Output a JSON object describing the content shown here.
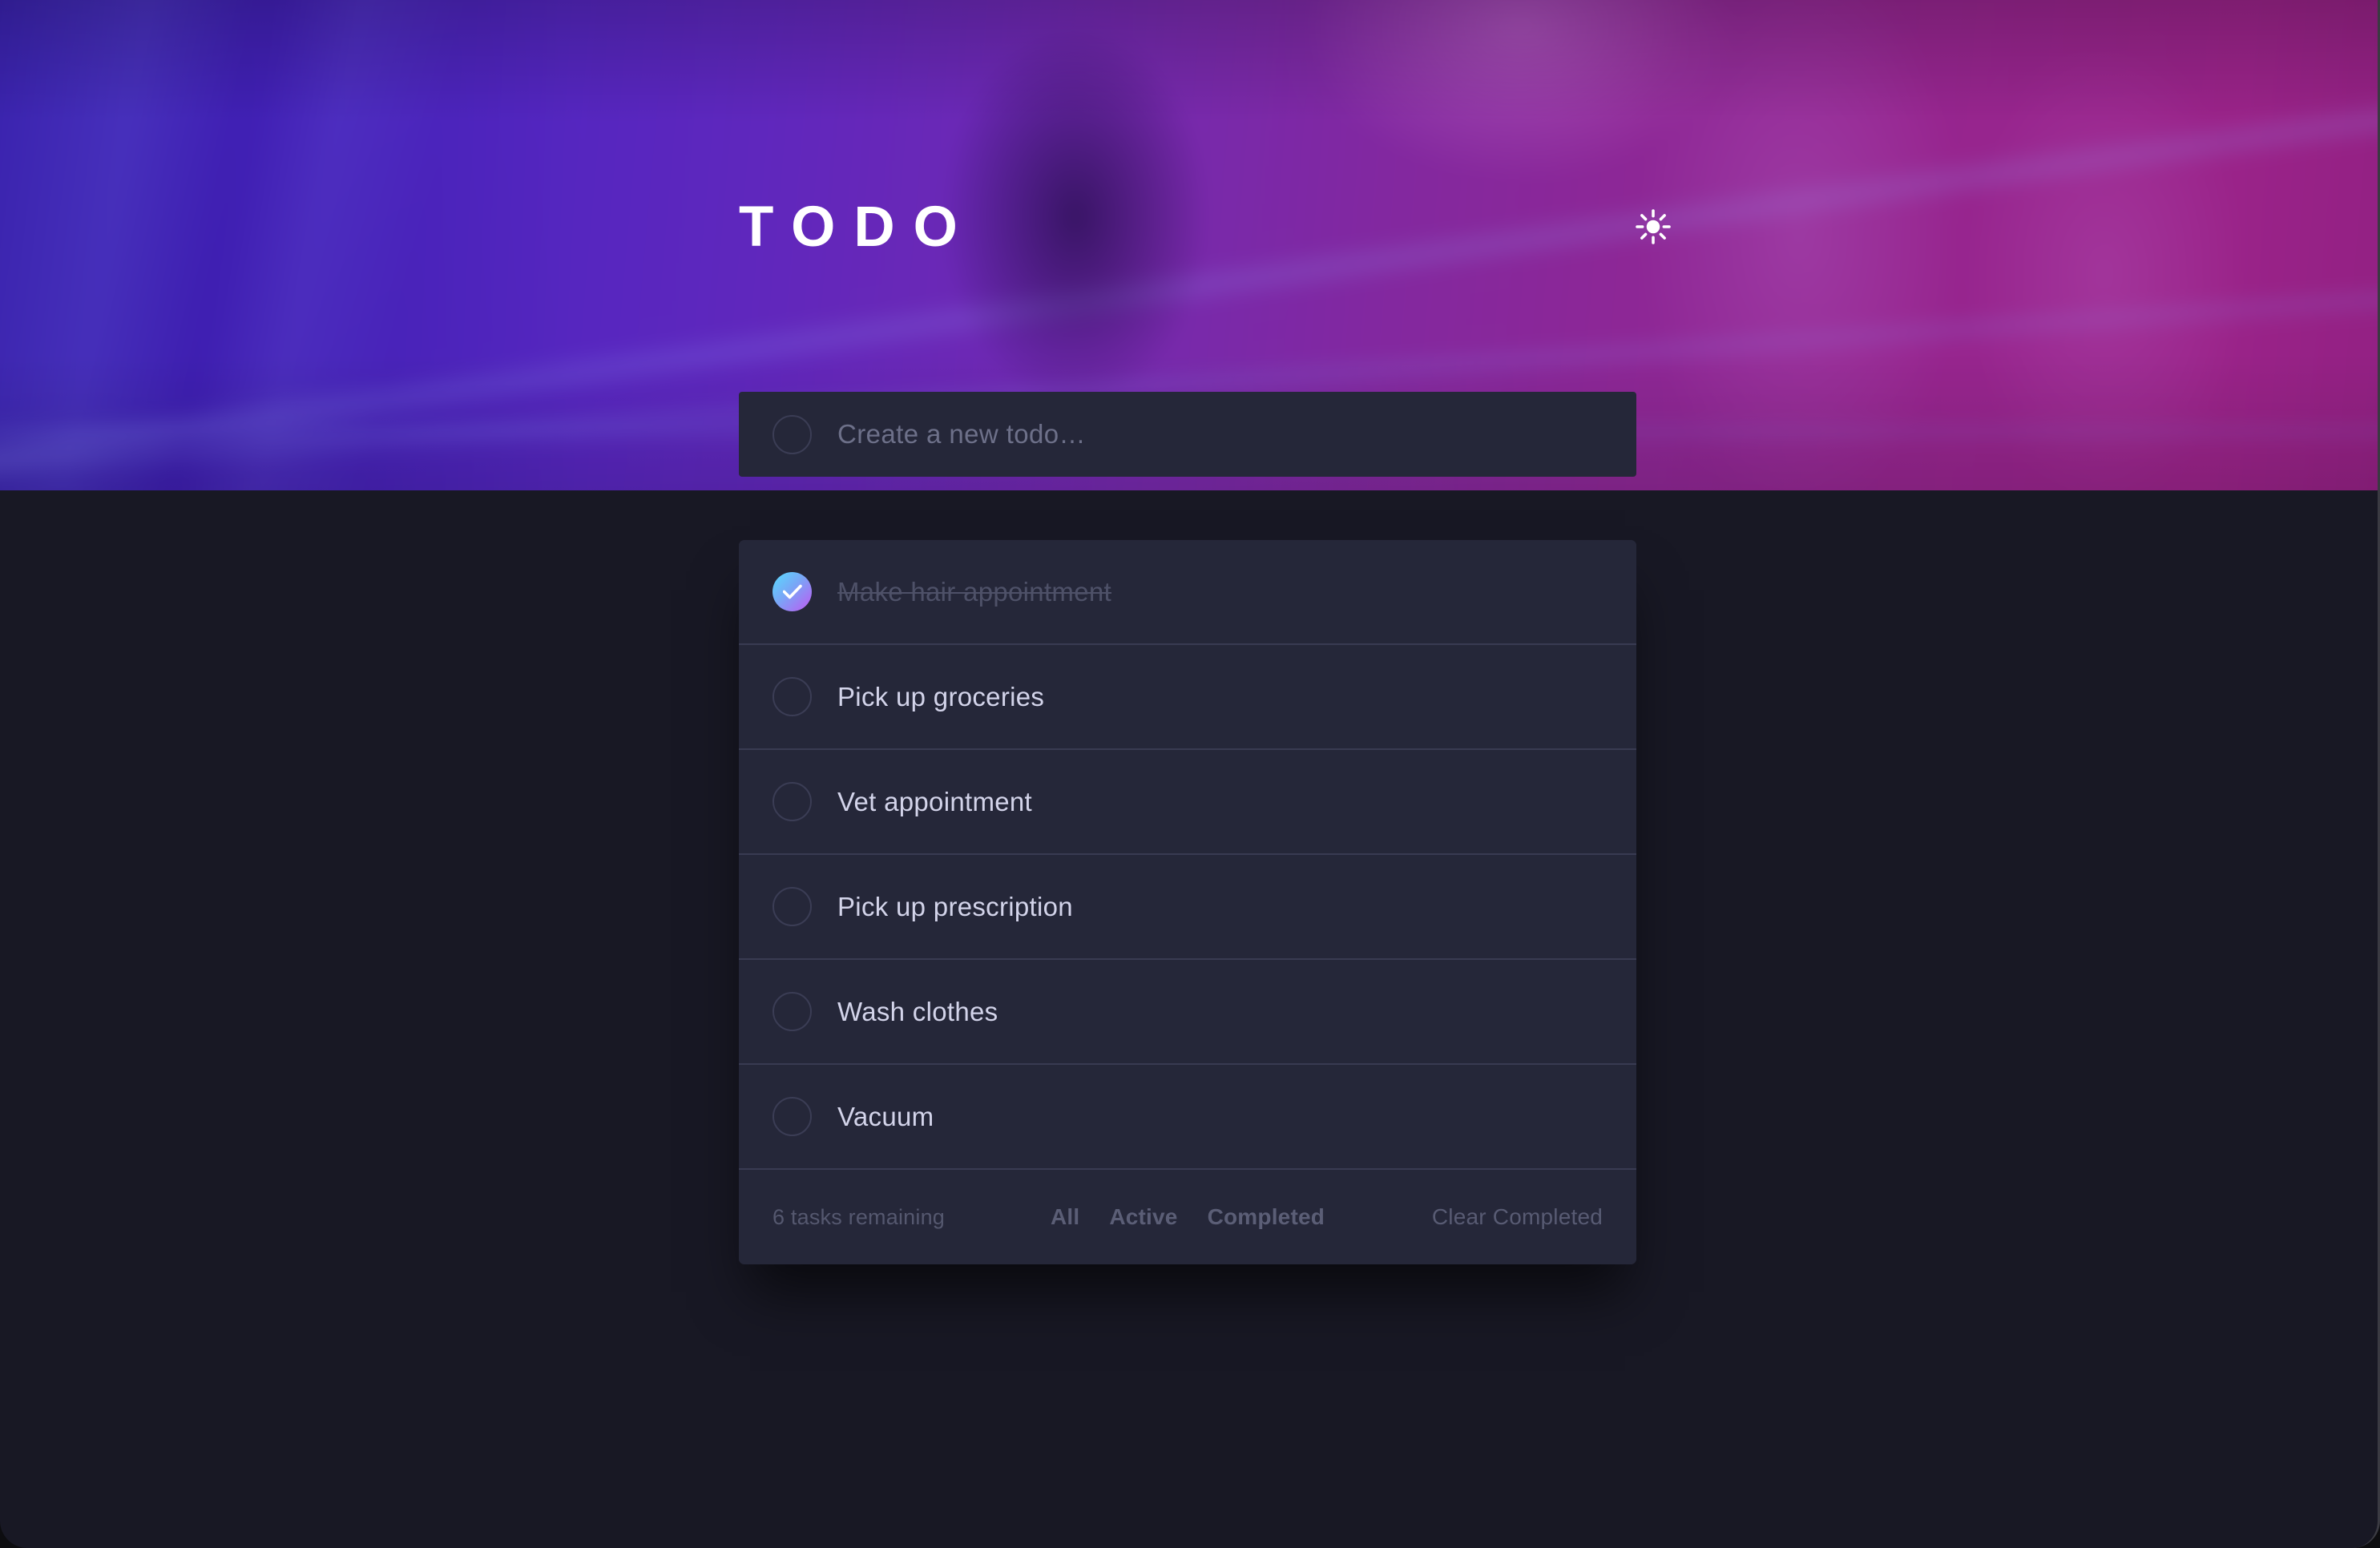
{
  "app": {
    "title": "TODO",
    "theme_toggle_icon": "sun-icon"
  },
  "create": {
    "placeholder": "Create a new todo…",
    "value": "",
    "checkbox_icon": "empty-circle-icon"
  },
  "todos": [
    {
      "label": "Make hair appointment",
      "completed": true
    },
    {
      "label": "Pick up groceries",
      "completed": false
    },
    {
      "label": "Vet appointment",
      "completed": false
    },
    {
      "label": "Pick up prescription",
      "completed": false
    },
    {
      "label": "Wash clothes",
      "completed": false
    },
    {
      "label": "Vacuum",
      "completed": false
    }
  ],
  "footer": {
    "tasks_remaining": "6 tasks remaining",
    "filters": [
      {
        "label": "All",
        "active": true
      },
      {
        "label": "Active",
        "active": false
      },
      {
        "label": "Completed",
        "active": false
      }
    ],
    "clear_label": "Clear Completed"
  },
  "colors": {
    "card_bg": "#252739",
    "page_bg": "#181824",
    "divider": "#393b52",
    "text_primary": "#d3d4ea",
    "text_muted": "#55586f",
    "text_completed": "#4e5168",
    "check_gradient_start": "#57ddff",
    "check_gradient_end": "#c058f3",
    "hero_blue": "#3a1fc9",
    "hero_magenta": "#9a2389"
  }
}
